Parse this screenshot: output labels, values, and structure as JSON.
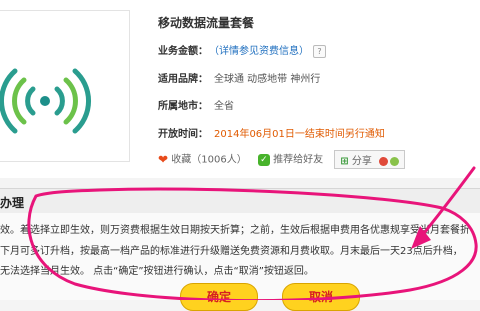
{
  "product": {
    "title": "移动数据流量套餐",
    "rows": [
      {
        "label": "业务金额：",
        "value": "（详情参见资费信息）",
        "style": "lnk",
        "help": true
      },
      {
        "label": "适用品牌：",
        "value": "全球通  动感地带  神州行",
        "style": "val"
      },
      {
        "label": "所属地市：",
        "value": "全省",
        "style": "val"
      },
      {
        "label": "开放时间：",
        "value": "2014年06月01日一结束时间另行通知",
        "style": "red"
      }
    ],
    "favorite_label": "收藏（1006人）",
    "recommend_label": "推荐给好友",
    "share_label": "分享"
  },
  "dialog": {
    "title": "办理",
    "lines": [
      "效。着选择立即生效，则万资费根据生效日期按天折算；之前，生效后根据申费用各优惠规享受当月套餐折",
      "下月可多订升档，按最高一档产品的标准进行升级赠送免费资源和月费收取。月末最后一天23点后升档，",
      "无法选择当月生效。 点击“确定”按钮进行确认，点击“取消”按钮返回。"
    ],
    "confirm_label": "确定",
    "cancel_label": "取消"
  },
  "colors": {
    "annotation": "#e8147a",
    "wifi": "#2a9d8f",
    "button": "#ffd21f"
  }
}
